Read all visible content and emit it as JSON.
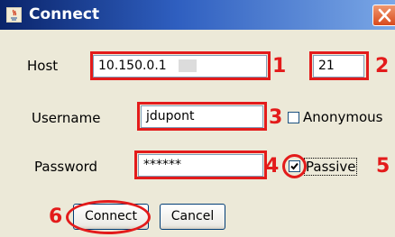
{
  "window": {
    "title": "Connect"
  },
  "form": {
    "host_label": "Host",
    "host_value": "10.150.0.1",
    "port_value": "21",
    "username_label": "Username",
    "username_value": "jdupont",
    "anonymous_label": "Anonymous",
    "anonymous_checked": false,
    "password_label": "Password",
    "password_value": "******",
    "passive_label": "Passive",
    "passive_checked": true
  },
  "buttons": {
    "connect": "Connect",
    "cancel": "Cancel"
  },
  "callouts": [
    "1",
    "2",
    "3",
    "4",
    "5",
    "6"
  ],
  "colors": {
    "annotation": "#e31b1b",
    "titlebar": "#0a246a"
  }
}
